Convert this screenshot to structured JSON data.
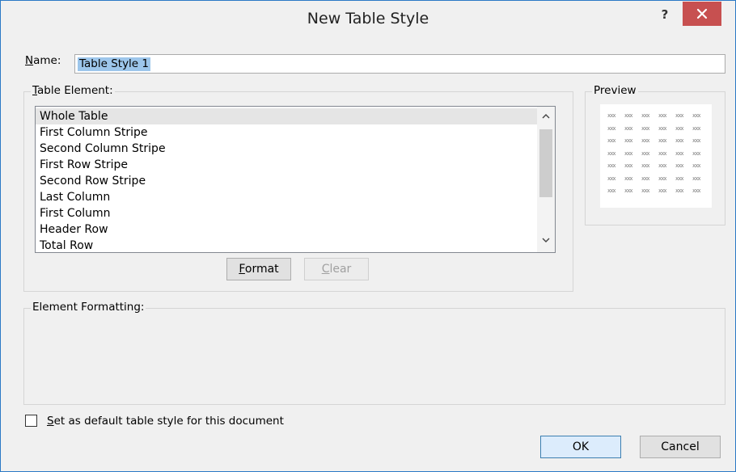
{
  "window": {
    "title": "New Table Style",
    "help_label": "?"
  },
  "name_field": {
    "label_mnemonic": "N",
    "label_rest": "ame:",
    "value": "Table Style 1"
  },
  "table_element": {
    "legend_mnemonic": "T",
    "legend_rest": "able Element:",
    "items": [
      {
        "label": "Whole Table",
        "selected": true
      },
      {
        "label": "First Column Stripe",
        "selected": false
      },
      {
        "label": "Second Column Stripe",
        "selected": false
      },
      {
        "label": "First Row Stripe",
        "selected": false
      },
      {
        "label": "Second Row Stripe",
        "selected": false
      },
      {
        "label": "Last Column",
        "selected": false
      },
      {
        "label": "First Column",
        "selected": false
      },
      {
        "label": "Header Row",
        "selected": false
      },
      {
        "label": "Total Row",
        "selected": false
      }
    ],
    "format_button": {
      "mnemonic": "F",
      "rest": "ormat"
    },
    "clear_button": {
      "mnemonic": "C",
      "rest": "lear",
      "disabled": true
    }
  },
  "preview": {
    "legend": "Preview",
    "cell_text": "xxx",
    "rows": 7,
    "cols": 6
  },
  "element_formatting": {
    "legend": "Element Formatting:"
  },
  "default_checkbox": {
    "checked": false,
    "label_mnemonic": "S",
    "label_rest": "et as default table style for this document"
  },
  "buttons": {
    "ok": "OK",
    "cancel": "Cancel"
  },
  "colors": {
    "accent_border": "#2b79c5",
    "close_button": "#c75050",
    "selection_highlight": "#9dc6eb",
    "list_selected": "#e5e5e5"
  }
}
